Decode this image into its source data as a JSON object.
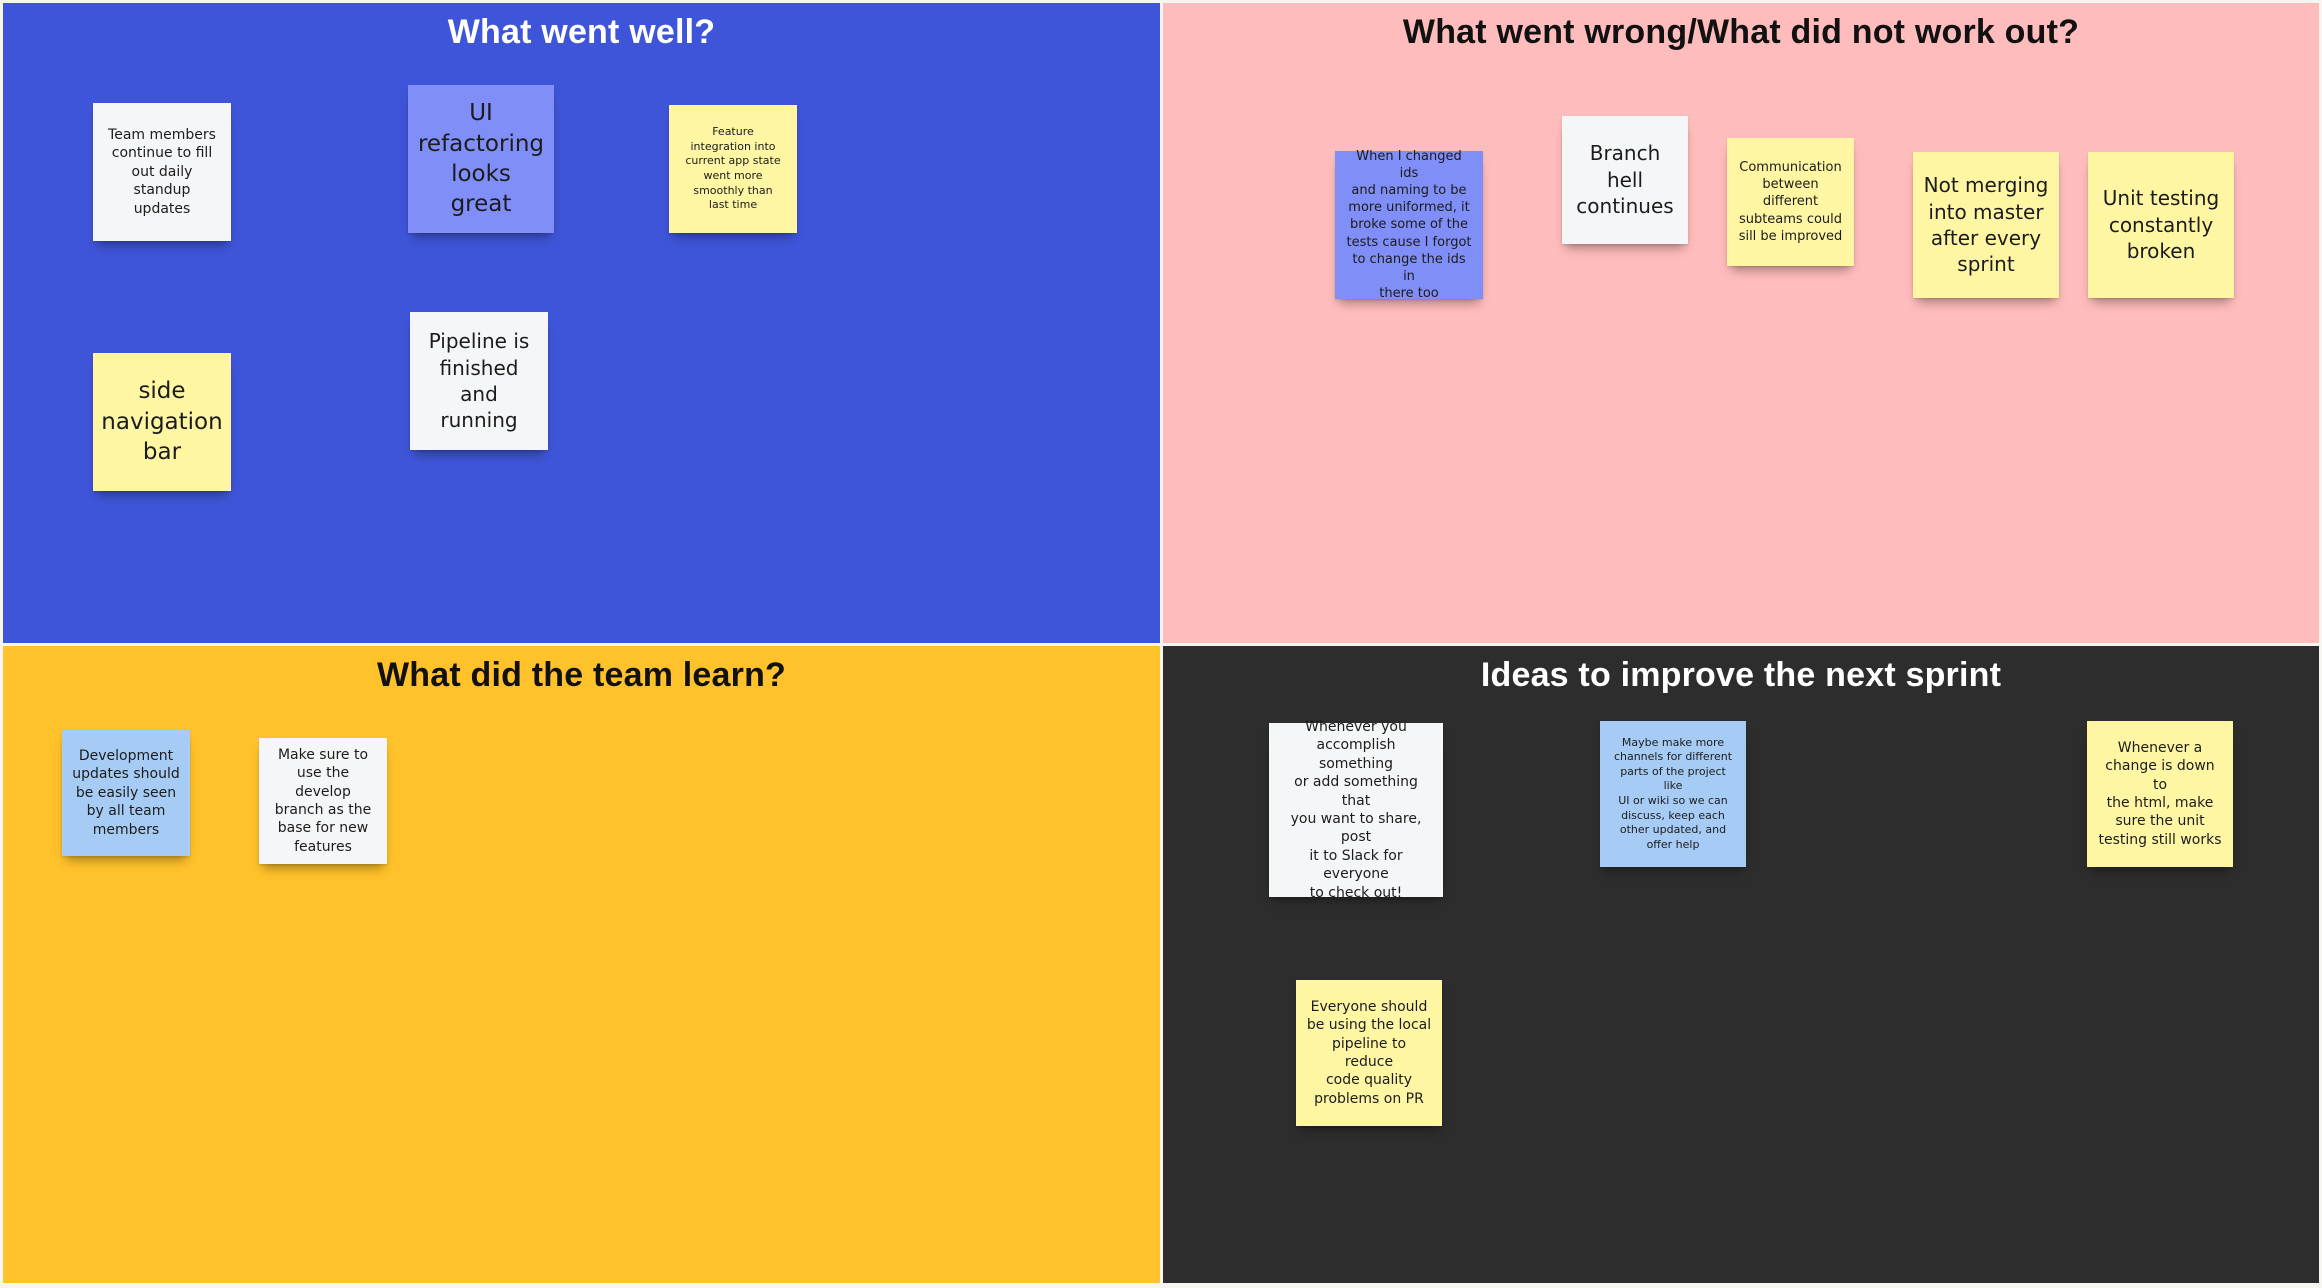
{
  "board": {
    "colors": {
      "went_well": "#3f55d9",
      "went_wrong": "#ffbcbc",
      "learned": "#ffc22b",
      "ideas": "#2d2d2d",
      "note_white": "#f5f6f8",
      "note_yellow": "#fff6a3",
      "note_blue": "#808ef7",
      "note_light_blue": "#a6ccf5"
    },
    "sections": {
      "went_well": {
        "title": "What went well?",
        "notes": [
          "Team members\ncontinue to fill\nout daily\nstandup\nupdates",
          "UI\nrefactoring\nlooks great",
          "Feature\nintegration into\ncurrent app state\nwent more\nsmoothly than\nlast time",
          "side\nnavigation\nbar",
          "Pipeline is\nfinished\nand\nrunning"
        ]
      },
      "went_wrong": {
        "title": "What went wrong/What did not work out?",
        "notes": [
          "When I changed ids\nand naming to be\nmore uniformed, it\nbroke some of the\ntests cause I forgot\nto change the ids in\nthere too",
          "Branch\nhell\ncontinues",
          "Communication\nbetween\ndifferent\nsubteams could\nsill be improved",
          "Not merging\ninto master\nafter every\nsprint",
          "Unit testing\nconstantly\nbroken"
        ]
      },
      "learned": {
        "title": "What did the team learn?",
        "notes": [
          "Development\nupdates should\nbe easily seen\nby all team\nmembers",
          "Make sure to\nuse the develop\nbranch as the\nbase for new\nfeatures"
        ]
      },
      "ideas": {
        "title": "Ideas to improve the next sprint",
        "notes": [
          "Whenever you\naccomplish something\nor add something that\nyou want to share, post\nit to Slack for everyone\nto check out!",
          "Maybe make more\nchannels for different\nparts of the project like\nUI or wiki so we can\ndiscuss, keep each\nother updated, and\noffer help",
          "Whenever a\nchange is down to\nthe html, make\nsure the unit\ntesting still works",
          "Everyone should\nbe using the local\npipeline to reduce\ncode quality\nproblems on PR"
        ]
      }
    }
  }
}
